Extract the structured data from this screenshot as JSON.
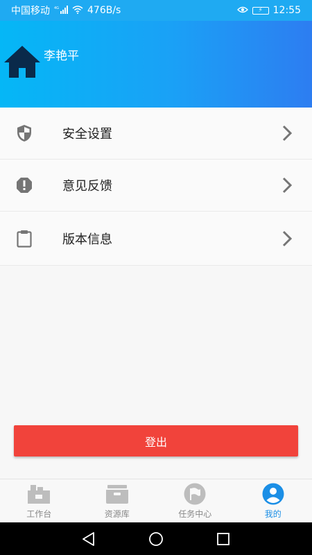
{
  "status_bar": {
    "carrier": "中国移动",
    "network": "4G",
    "speed": "476B/s",
    "time": "12:55"
  },
  "header": {
    "user_name": "李艳平",
    "icon": "home-icon"
  },
  "menu": {
    "items": [
      {
        "label": "安全设置",
        "icon": "shield-icon"
      },
      {
        "label": "意见反馈",
        "icon": "alert-icon"
      },
      {
        "label": "版本信息",
        "icon": "clipboard-icon"
      }
    ]
  },
  "actions": {
    "logout_label": "登出"
  },
  "tabs": [
    {
      "label": "工作台",
      "icon": "workbench-icon",
      "active": false
    },
    {
      "label": "资源库",
      "icon": "archive-icon",
      "active": false
    },
    {
      "label": "任务中心",
      "icon": "flag-icon",
      "active": false
    },
    {
      "label": "我的",
      "icon": "person-icon",
      "active": true
    }
  ],
  "colors": {
    "accent": "#1faaf2",
    "danger": "#f1433b",
    "active_tab": "#1c8fe6"
  }
}
